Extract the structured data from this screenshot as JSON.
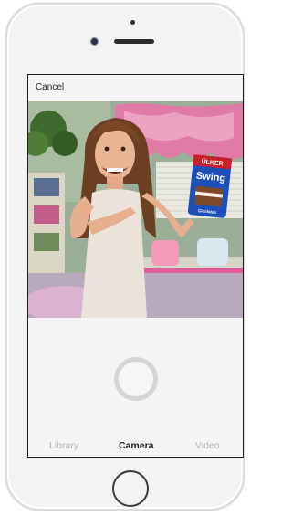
{
  "header": {
    "cancel_label": "Cancel"
  },
  "tabs": [
    {
      "label": "Library",
      "selected": false
    },
    {
      "label": "Camera",
      "selected": true
    },
    {
      "label": "Video",
      "selected": false
    }
  ],
  "snack_package": {
    "brand": "Swing",
    "top_text": "ÜLKER",
    "bottom_text": "Çikolatalı"
  },
  "colors": {
    "active_tab": "#1d1d1d",
    "inactive_tab": "#b7b7b7",
    "shutter_ring": "#d5d5d5",
    "phone_body": "#f3f3f3",
    "snack_blue": "#1d4fb8"
  },
  "icons": {
    "shutter": "shutter-button-icon",
    "home": "home-button-icon"
  }
}
